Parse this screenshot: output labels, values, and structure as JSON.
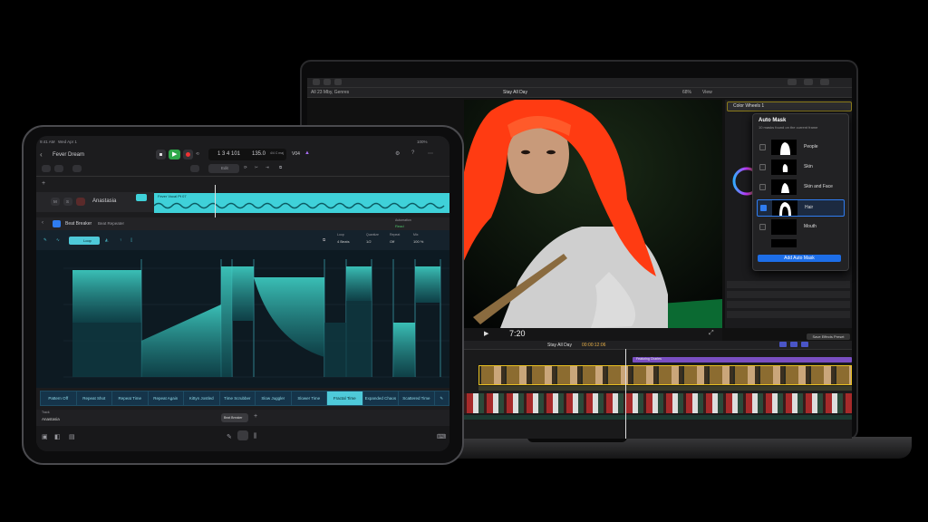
{
  "macbook": {
    "fcp": {
      "library_label": "All 23 Mby, Genres",
      "event_title": "Stay All Day",
      "zoom": "68%",
      "view_menu": "View",
      "inspector_title": "Color Wheels 1",
      "auto_mask": {
        "title": "Auto Mask",
        "subtitle": "10 masks found on the current frame",
        "items": [
          {
            "label": "People",
            "checked": false
          },
          {
            "label": "Skin",
            "checked": false
          },
          {
            "label": "Skin and Face",
            "checked": false
          },
          {
            "label": "Hair",
            "checked": true
          },
          {
            "label": "Mouth",
            "checked": false
          }
        ],
        "button": "Add Auto Mask"
      },
      "timecode": "7:20",
      "timeline_project": "Stay All Day",
      "timeline_time": "00:00:12:06",
      "save_effects_button": "Save Effects Preset",
      "clip_label": "Featuring Charles"
    }
  },
  "ipad": {
    "status": {
      "time": "9:41 AM",
      "date": "Wed Apr 1",
      "battery": "100%"
    },
    "project_title": "Fever Dream",
    "transport": {
      "position": "1 3 4 101",
      "tempo": "135.0",
      "key": "4/4 C maj",
      "track_count": "V04"
    },
    "edit_label": "Edit",
    "track": {
      "name": "Anastasia",
      "m": "M",
      "s": "S"
    },
    "region_label": "Fever Vocal Pt 07",
    "plugin": {
      "name": "Beat Breaker",
      "preset": "Beat Repeater",
      "mode": "Automation",
      "mode_value": "Read"
    },
    "params": [
      {
        "label": "Loop",
        "value": "4 Beats"
      },
      {
        "label": "Quantize",
        "value": "1/2"
      },
      {
        "label": "Repeat",
        "value": "Off"
      },
      {
        "label": "Mix",
        "value": "100 %"
      }
    ],
    "chips": [
      "Loop"
    ],
    "presets": [
      "Pattern Off",
      "Repeat Shot",
      "Repeat Time",
      "Repeat Again",
      "Kittyn Jostled",
      "Time Scrubber",
      "Slow Juggler",
      "Slower Time",
      "Fractal Time",
      "Expanded Chaos",
      "Scattered Time"
    ],
    "active_preset_index": 8,
    "footer": {
      "track_label": "Track",
      "track_value": "Anastasia",
      "plugin_pill": "Beat Breaker"
    },
    "colors": {
      "accent": "#4ec9d9",
      "region": "#3fd1d9",
      "mask_btn": "#1d6ee8"
    }
  }
}
